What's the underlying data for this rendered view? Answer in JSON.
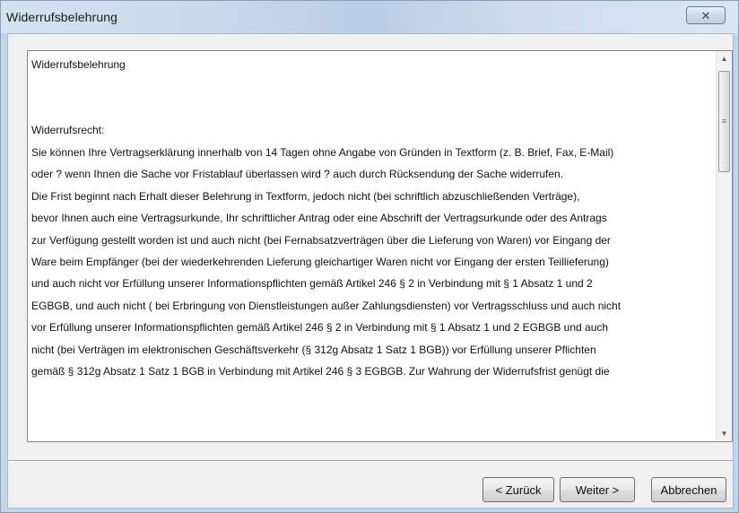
{
  "window": {
    "title": "Widerrufsbelehrung",
    "close_label": "✕"
  },
  "textbox": {
    "lines": [
      "Widerrufsbelehrung",
      "",
      "",
      "Widerrufsrecht:",
      "Sie können Ihre Vertragserklärung innerhalb von 14 Tagen ohne Angabe von Gründen in Textform (z. B. Brief, Fax, E-Mail)",
      "oder ? wenn Ihnen die Sache vor Fristablauf überlassen wird ? auch durch Rücksendung der Sache widerrufen.",
      "Die Frist beginnt nach Erhalt dieser Belehrung in Textform, jedoch nicht (bei schriftlich abzuschließenden Verträge),",
      "bevor Ihnen auch eine Vertragsurkunde, Ihr schriftlicher Antrag oder eine Abschrift der Vertragsurkunde oder des Antrags",
      "zur Verfügung gestellt worden ist und auch nicht (bei Fernabsatzverträgen über die Lieferung von Waren) vor Eingang der",
      "Ware beim Empfänger (bei der wiederkehrenden Lieferung gleichartiger Waren nicht vor Eingang der ersten Teillieferung)",
      "und auch nicht vor Erfüllung unserer Informationspflichten gemäß Artikel 246 § 2 in Verbindung mit § 1 Absatz 1 und 2",
      "EGBGB, und auch nicht ( bei Erbringung von Dienstleistungen außer Zahlungsdiensten) vor Vertragsschluss und auch nicht",
      "vor Erfüllung unserer Informationspflichten gemäß Artikel 246 § 2 in Verbindung mit § 1 Absatz 1 und 2 EGBGB und auch",
      "nicht (bei Verträgen im elektronischen Geschäftsverkehr (§ 312g Absatz 1 Satz 1 BGB)) vor Erfüllung unserer Pflichten",
      "gemäß § 312g Absatz 1 Satz 1 BGB in Verbindung mit Artikel 246 § 3 EGBGB. Zur Wahrung der Widerrufsfrist genügt die"
    ],
    "scroll_position": 0.05
  },
  "scrollbar": {
    "up_arrow": "▲",
    "down_arrow": "▼",
    "grip": "≡"
  },
  "buttons": {
    "back_label": "< Zurück",
    "next_label": "Weiter >",
    "cancel_label": "Abbrechen"
  }
}
